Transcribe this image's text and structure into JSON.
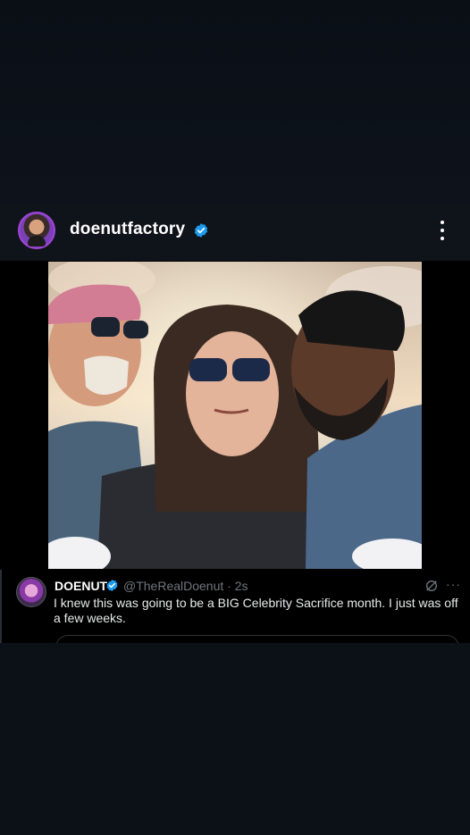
{
  "header": {
    "username": "doenutfactory"
  },
  "tweet": {
    "name": "DOENUT",
    "handle_time": "@TheRealDoenut · 2s",
    "text": "I knew this was going to be a BIG Celebrity Sacrifice month. I just was off a few weeks.",
    "more": "···"
  },
  "colors": {
    "verified": "#1d9bf0",
    "background": "#0c1118",
    "handle_gray": "#71767b"
  },
  "icons": [
    "avatar",
    "verified-badge-icon",
    "more-vertical-icon",
    "grok-icon",
    "more-horizontal-icon"
  ]
}
